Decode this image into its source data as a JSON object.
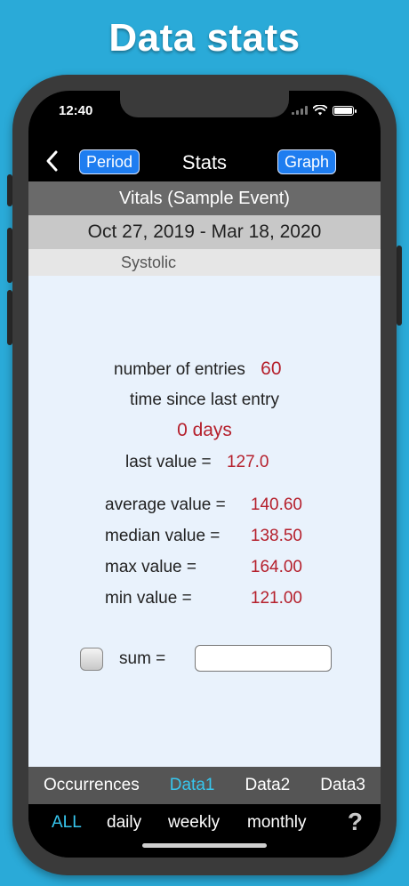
{
  "headline": "Data stats",
  "status": {
    "time": "12:40"
  },
  "nav": {
    "period_label": "Period",
    "title": "Stats",
    "graph_label": "Graph"
  },
  "event_title": "Vitals (Sample Event)",
  "period_range": "Oct 27, 2019 - Mar 18, 2020",
  "field_name": "Systolic",
  "stats": {
    "entries_label": "number of entries",
    "entries_value": "60",
    "since_label": "time since last entry",
    "since_value": "0 days",
    "last_label": "last value =",
    "last_value": "127.0",
    "average_label": "average value  =",
    "average_value": "140.60",
    "median_label": "median value  =",
    "median_value": "138.50",
    "max_label": "max value  =",
    "max_value": "164.00",
    "min_label": "min value  =",
    "min_value": "121.00",
    "sum_label": "sum =",
    "sum_checked": false
  },
  "tabs": [
    "Occurrences",
    "Data1",
    "Data2",
    "Data3"
  ],
  "active_tab": "Data1",
  "range_buttons": [
    "ALL",
    "daily",
    "weekly",
    "monthly"
  ],
  "active_range": "ALL",
  "help_icon": "question-mark-icon",
  "colors": {
    "accent": "#37c6ee",
    "value_red": "#b5202c",
    "nav_button": "#1e7df0",
    "background": "#2aaad8"
  }
}
